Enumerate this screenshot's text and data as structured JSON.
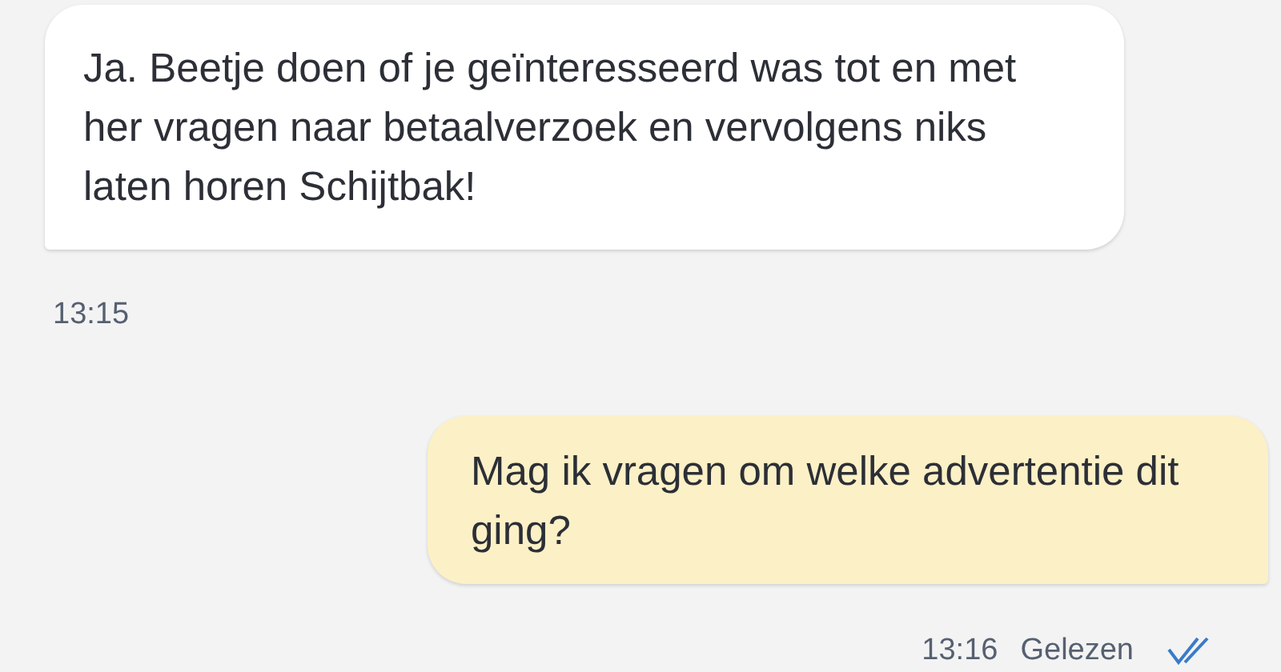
{
  "messages": [
    {
      "kind": "incoming",
      "text": "Ja. Beetje doen of je geïnteresseerd was tot en met her vragen naar betaalverzoek en vervolgens niks laten horen Schijtbak!",
      "time": "13:15"
    },
    {
      "kind": "outgoing",
      "text": "Mag ik vragen om welke advertentie dit ging?",
      "time": "13:16",
      "status": "Gelezen",
      "read": true
    }
  ]
}
